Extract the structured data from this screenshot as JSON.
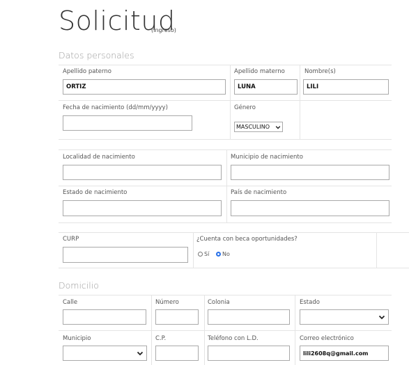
{
  "header": {
    "title": "Solicitud",
    "subtitle": "(Ingreso)"
  },
  "personal": {
    "section_label": "Datos personales",
    "apellido_paterno": {
      "label": "Apellido paterno",
      "value": "ORTIZ"
    },
    "apellido_materno": {
      "label": "Apellido materno",
      "value": "LUNA"
    },
    "nombres": {
      "label": "Nombre(s)",
      "value": "LILI"
    },
    "fecha_nacimiento": {
      "label": "Fecha de nacimiento (dd/mm/yyyy)",
      "value": ""
    },
    "genero": {
      "label": "Género",
      "value": "MASCULINO"
    },
    "localidad": {
      "label": "Localidad de nacimiento",
      "value": ""
    },
    "municipio_nac": {
      "label": "Municipio de nacimiento",
      "value": ""
    },
    "estado_nac": {
      "label": "Estado de nacimiento",
      "value": ""
    },
    "pais_nac": {
      "label": "País de nacimiento",
      "value": ""
    },
    "curp": {
      "label": "CURP",
      "value": ""
    },
    "beca": {
      "label": "¿Cuenta con beca oportunidades?",
      "option_yes": "Sí",
      "option_no": "No",
      "selected": "No"
    }
  },
  "domicilio": {
    "section_label": "Domicilio",
    "calle": {
      "label": "Calle",
      "value": ""
    },
    "numero": {
      "label": "Número",
      "value": ""
    },
    "colonia": {
      "label": "Colonia",
      "value": ""
    },
    "estado": {
      "label": "Estado",
      "value": ""
    },
    "municipio": {
      "label": "Municipio",
      "value": ""
    },
    "cp": {
      "label": "C.P.",
      "value": ""
    },
    "telefono": {
      "label": "Teléfono con L.D.",
      "value": ""
    },
    "correo": {
      "label": "Correo electrónico",
      "value": "lili2608q@gmail.com"
    }
  },
  "icons": {
    "select_chevron": "chevron-down-icon"
  }
}
